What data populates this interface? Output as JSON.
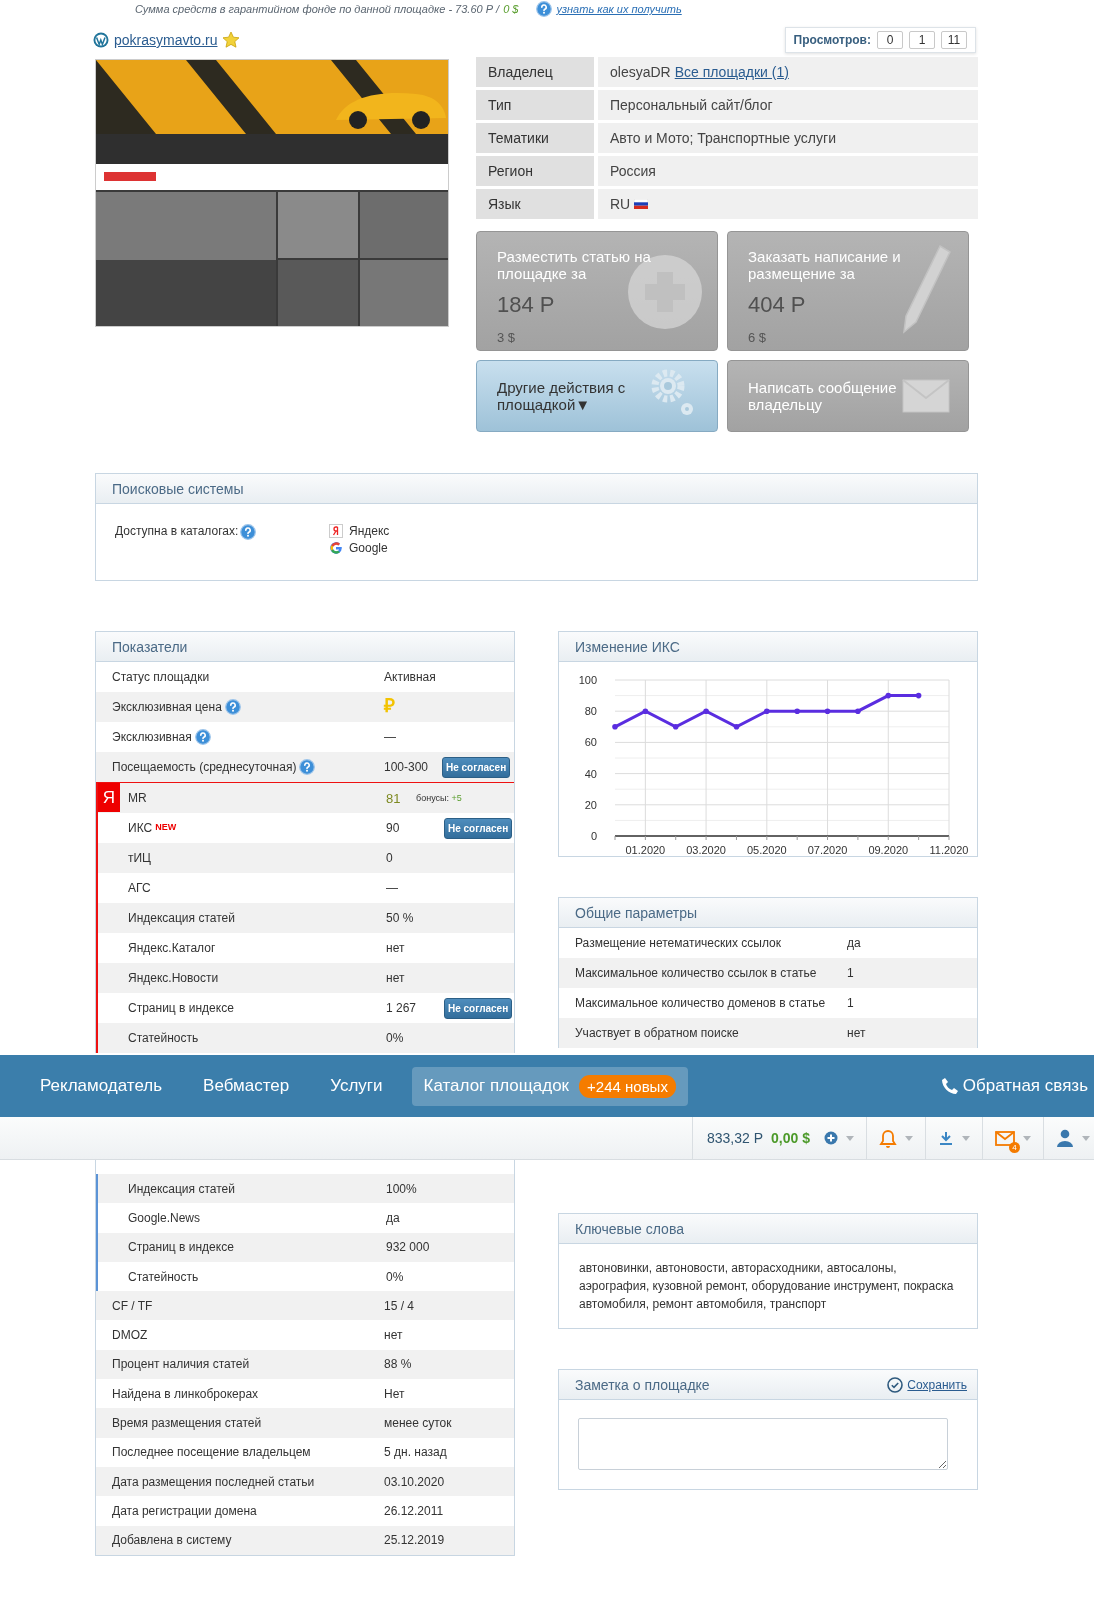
{
  "guarantee": {
    "text": "Сумма средств в гарантийном фонде по данной площадке - 73.60 Р / ",
    "usd": "0 $",
    "link": "узнать как их получить"
  },
  "site": {
    "domain": "pokrasymavto.ru",
    "favorite": true,
    "views_label": "Просмотров:",
    "views": [
      "0",
      "1",
      "11"
    ]
  },
  "info": [
    {
      "label": "Владелец",
      "value": "olesyaDR",
      "link": "Все площадки (1)"
    },
    {
      "label": "Тип",
      "value": "Персональный сайт/блог"
    },
    {
      "label": "Тематики",
      "value": "Авто и Мото; Транспортные услуги"
    },
    {
      "label": "Регион",
      "value": "Россия"
    },
    {
      "label": "Язык",
      "value": "RU",
      "flag": true
    }
  ],
  "actions": [
    {
      "kind": "plus",
      "title": "Разместить статью на площадке за",
      "price": "184 Р",
      "usd": "3 $",
      "disabled": true
    },
    {
      "kind": "pencil",
      "title": "Заказать написание и размещение за",
      "price": "404 Р",
      "usd": "6 $",
      "disabled": true
    },
    {
      "kind": "gears",
      "title": "Другие действия с площадкой▼",
      "disabled": false
    },
    {
      "kind": "envelope",
      "title": "Написать сообщение владельцу",
      "disabled": true
    }
  ],
  "search_engines": {
    "title": "Поисковые системы",
    "label": "Доступна в каталогах:",
    "engines": [
      {
        "kind": "yandex",
        "name": "Яндекс"
      },
      {
        "kind": "google",
        "name": "Google"
      }
    ]
  },
  "indicators": {
    "title": "Показатели",
    "rows": [
      {
        "kind": "plain",
        "label": "Статус площадки",
        "value": "Активная"
      },
      {
        "kind": "currency",
        "label": "Эксклюзивная цена",
        "value": "₽",
        "help": true
      },
      {
        "kind": "plain",
        "label": "Эксклюзивная",
        "value": "—",
        "help": true
      },
      {
        "kind": "plain",
        "label": "Посещаемость (среднесуточная)",
        "value": "100-300",
        "help": true,
        "button": "Не согласен"
      }
    ],
    "yandex_group": {
      "badge": "Я",
      "rows": [
        {
          "kind": "score",
          "label": "MR",
          "value": "81",
          "bonus_label": "бонусы:",
          "bonus": "+5"
        },
        {
          "kind": "plain",
          "label": "ИКС",
          "new_badge": "NEW",
          "value": "90",
          "button": "Не согласен"
        },
        {
          "kind": "plain",
          "label": "тИЦ",
          "value": "0"
        },
        {
          "kind": "plain",
          "label": "АГС",
          "value": "—"
        },
        {
          "kind": "plain",
          "label": "Индексация статей",
          "value": "50 %"
        },
        {
          "kind": "plain",
          "label": "Яндекс.Каталог",
          "value": "нет"
        },
        {
          "kind": "plain",
          "label": "Яндекс.Новости",
          "value": "нет"
        },
        {
          "kind": "plain",
          "label": "Страниц в индексе",
          "value": "1 267",
          "button": "Не согласен"
        },
        {
          "kind": "plain",
          "label": "Статейность",
          "value": "0%"
        }
      ]
    }
  },
  "ics_chart": {
    "title": "Изменение ИКС",
    "chart_data": {
      "type": "line",
      "categories": [
        null,
        "01.2020",
        null,
        "03.2020",
        null,
        "05.2020",
        null,
        "07.2020",
        null,
        "09.2020",
        null,
        "11.2020"
      ],
      "series": [
        {
          "color": "#5a2de0",
          "values": [
            70,
            80,
            70,
            80,
            70,
            80,
            80,
            80,
            80,
            90,
            90,
            null
          ]
        }
      ],
      "ylim": [
        0,
        100
      ],
      "grid": true,
      "yticks": [
        0,
        20,
        40,
        60,
        80,
        100
      ]
    }
  },
  "general": {
    "title": "Общие параметры",
    "rows": [
      {
        "label": "Размещение нетематических ссылок",
        "value": "да"
      },
      {
        "label": "Максимальное количество ссылок в статье",
        "value": "1"
      },
      {
        "label": "Максимальное количество доменов в статье",
        "value": "1"
      },
      {
        "label": "Участвует в обратном поиске",
        "value": "нет"
      }
    ]
  },
  "navbar": {
    "items": [
      {
        "label": "Рекламодатель",
        "selected": false
      },
      {
        "label": "Вебмастер",
        "selected": false
      },
      {
        "label": "Услуги",
        "selected": false
      },
      {
        "label": "Каталог площадок",
        "selected": true,
        "badge": "+244 новых"
      }
    ],
    "feedback": "Обратная связь"
  },
  "toolbar": {
    "balance_rub": "833,32 Р",
    "balance_usd": "0,00 $",
    "mail_count": "4"
  },
  "indicators_continued": {
    "google_group": {
      "rows": [
        {
          "kind": "plain",
          "label": "Индексация статей",
          "value": "100%"
        },
        {
          "kind": "plain",
          "label": "Google.News",
          "value": "да"
        },
        {
          "kind": "plain",
          "label": "Страниц в индексе",
          "value": "932 000"
        },
        {
          "kind": "plain",
          "label": "Статейность",
          "value": "0%"
        }
      ]
    },
    "rows": [
      {
        "kind": "plain",
        "label": "CF / TF",
        "value": "15 / 4"
      },
      {
        "kind": "plain",
        "label": "DMOZ",
        "value": "нет"
      },
      {
        "kind": "plain",
        "label": "Процент наличия статей",
        "value": "88 %"
      },
      {
        "kind": "plain",
        "label": "Найдена в линкоброкерах",
        "value": "Нет"
      },
      {
        "kind": "plain",
        "label": "Время размещения статей",
        "value": "менее суток"
      },
      {
        "kind": "plain",
        "label": "Последнее посещение владельцем",
        "value": "5 дн. назад"
      },
      {
        "kind": "plain",
        "label": "Дата размещения последней статьи",
        "value": "03.10.2020"
      },
      {
        "kind": "plain",
        "label": "Дата регистрации домена",
        "value": "26.12.2011"
      },
      {
        "kind": "plain",
        "label": "Добавлена в систему",
        "value": "25.12.2019"
      }
    ]
  },
  "keywords": {
    "title": "Ключевые слова",
    "text": "автоновинки, автоновости, авторасходники, автосалоны, аэрография, кузовной ремонт, оборудование инструмент, покраска автомобиля, ремонт автомобиля, транспорт"
  },
  "note": {
    "title": "Заметка о площадке",
    "save": "Сохранить"
  }
}
